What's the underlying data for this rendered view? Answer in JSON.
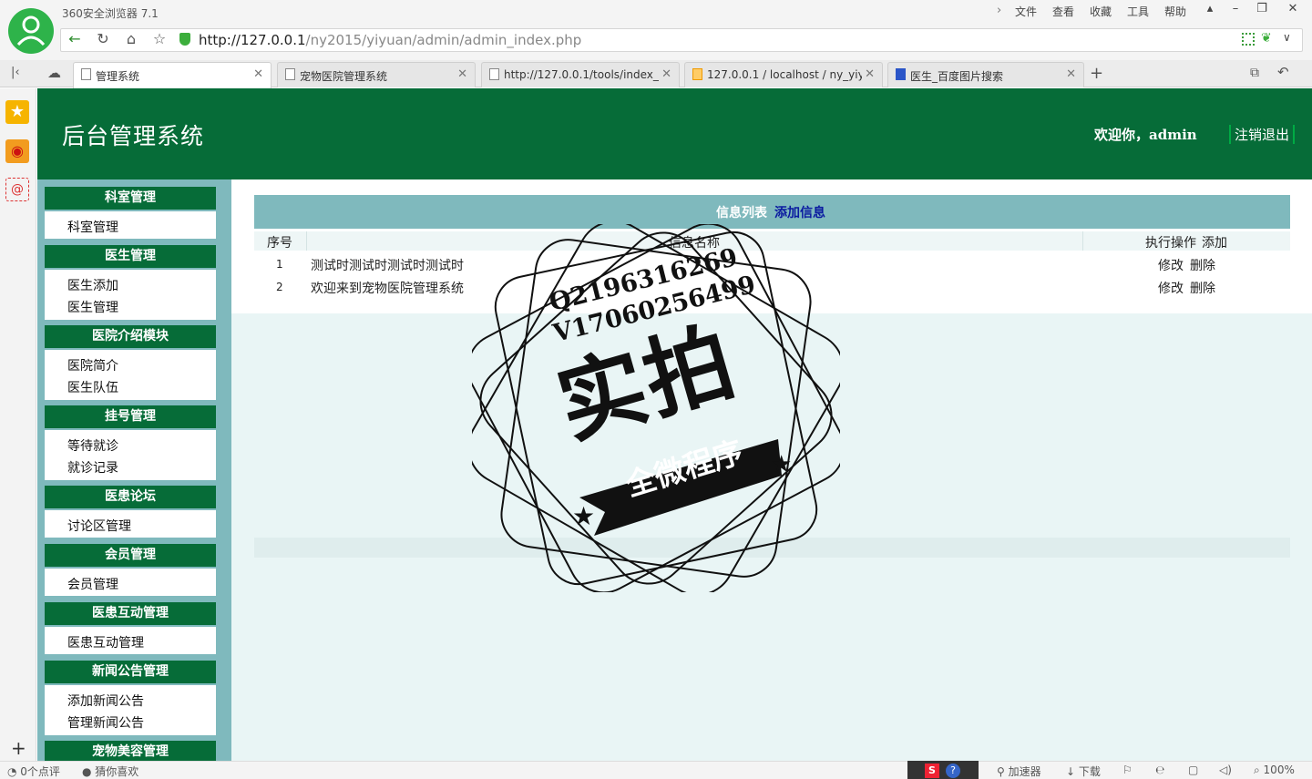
{
  "browser": {
    "name": "360安全浏览器 7.1",
    "menus": [
      "文件",
      "查看",
      "收藏",
      "工具",
      "帮助"
    ],
    "url_host": "http://127.0.0.1",
    "url_path": "/ny2015/yiyuan/admin/admin_index.php",
    "tabs": [
      {
        "label": "管理系统",
        "active": true
      },
      {
        "label": "宠物医院管理系统",
        "active": false
      },
      {
        "label": "http://127.0.0.1/tools/index_",
        "active": false
      },
      {
        "label": "127.0.0.1 / localhost / ny_yiyu",
        "active": false
      },
      {
        "label": "医生_百度图片搜索",
        "active": false
      }
    ]
  },
  "header": {
    "title": "后台管理系统",
    "welcome": "欢迎你，admin",
    "logout": "注销退出"
  },
  "menu": {
    "groups": [
      {
        "title": "科室管理",
        "links": [
          "科室管理"
        ]
      },
      {
        "title": "医生管理",
        "links": [
          "医生添加",
          "医生管理"
        ]
      },
      {
        "title": "医院介绍模块",
        "links": [
          "医院简介",
          "医生队伍"
        ]
      },
      {
        "title": "挂号管理",
        "links": [
          "等待就诊",
          "就诊记录"
        ]
      },
      {
        "title": "医患论坛",
        "links": [
          "讨论区管理"
        ]
      },
      {
        "title": "会员管理",
        "links": [
          "会员管理"
        ]
      },
      {
        "title": "医患互动管理",
        "links": [
          "医患互动管理"
        ]
      },
      {
        "title": "新闻公告管理",
        "links": [
          "添加新闻公告",
          "管理新闻公告"
        ]
      },
      {
        "title": "宠物美容管理",
        "links": []
      }
    ]
  },
  "list": {
    "title": "信息列表",
    "add_link": "添加信息",
    "columns": [
      "序号",
      "信息名称",
      "执行操作",
      "添加"
    ],
    "rows": [
      {
        "index": "1",
        "name": "测试时测试时测试时测试时",
        "edit": "修改",
        "delete": "删除"
      },
      {
        "index": "2",
        "name": "欢迎来到宠物医院管理系统",
        "edit": "修改",
        "delete": "删除"
      }
    ]
  },
  "watermark": {
    "line1": "Q2196316269",
    "line2": "V17060256499",
    "big": "实拍",
    "banner": "全微程序"
  },
  "statusbar": {
    "comments": "0个点评",
    "likes": "猜你喜欢",
    "accelerator": "加速器",
    "download": "下载",
    "zoom": "100%"
  },
  "colors": {
    "header_green": "#066c38",
    "menu_teal": "#7fb9bd",
    "content_bg": "#e9f5f5",
    "link_blue": "#0a1aa0"
  }
}
